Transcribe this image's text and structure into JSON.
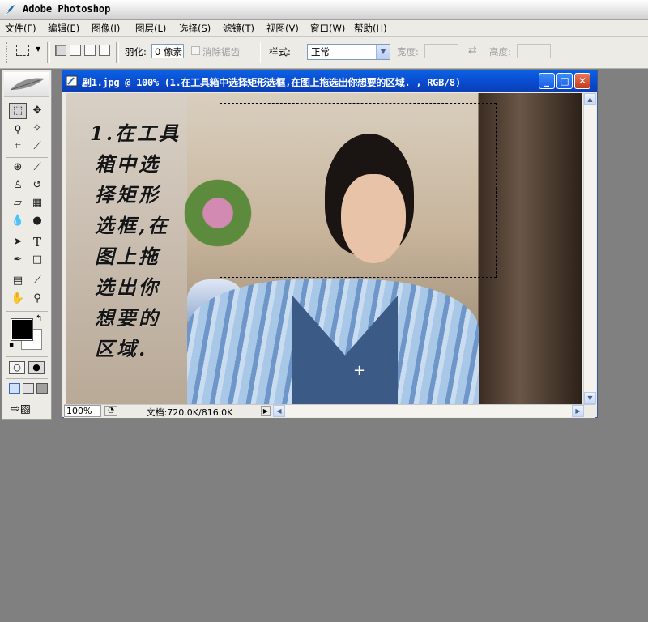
{
  "app": {
    "title": "Adobe Photoshop"
  },
  "menu": [
    "文件(F)",
    "编辑(E)",
    "图像(I)",
    "图层(L)",
    "选择(S)",
    "滤镜(T)",
    "视图(V)",
    "窗口(W)",
    "帮助(H)"
  ],
  "options": {
    "feather_label": "羽化:",
    "feather_value": "0 像素",
    "antialias_label": "消除锯齿",
    "style_label": "样式:",
    "style_value": "正常",
    "width_label": "宽度:",
    "height_label": "高度:"
  },
  "document": {
    "title": "剧1.jpg @ 100% (1.在工具箱中选择矩形选框,在图上拖选出你想要的区域.  , RGB/8)",
    "calligraphy": [
      "1.在工具",
      "箱中选",
      "择矩形",
      "选框,在",
      "图上拖",
      "选出你",
      "想要的",
      "区域."
    ],
    "zoom": "100%",
    "doc_info": "文档:720.0K/816.0K"
  },
  "colors": {
    "foreground": "#000000",
    "background": "#ffffff",
    "doc_titlebar": "#0a4bd0"
  },
  "icons": [
    "photoshop-feather-icon",
    "rect-marquee-icon",
    "move-icon",
    "lasso-icon",
    "magic-wand-icon",
    "crop-icon",
    "slice-icon",
    "healing-brush-icon",
    "brush-icon",
    "clone-stamp-icon",
    "history-brush-icon",
    "eraser-icon",
    "gradient-icon",
    "blur-icon",
    "dodge-icon",
    "path-select-icon",
    "type-icon",
    "pen-icon",
    "shape-icon",
    "notes-icon",
    "eyedropper-icon",
    "hand-icon",
    "zoom-icon"
  ]
}
